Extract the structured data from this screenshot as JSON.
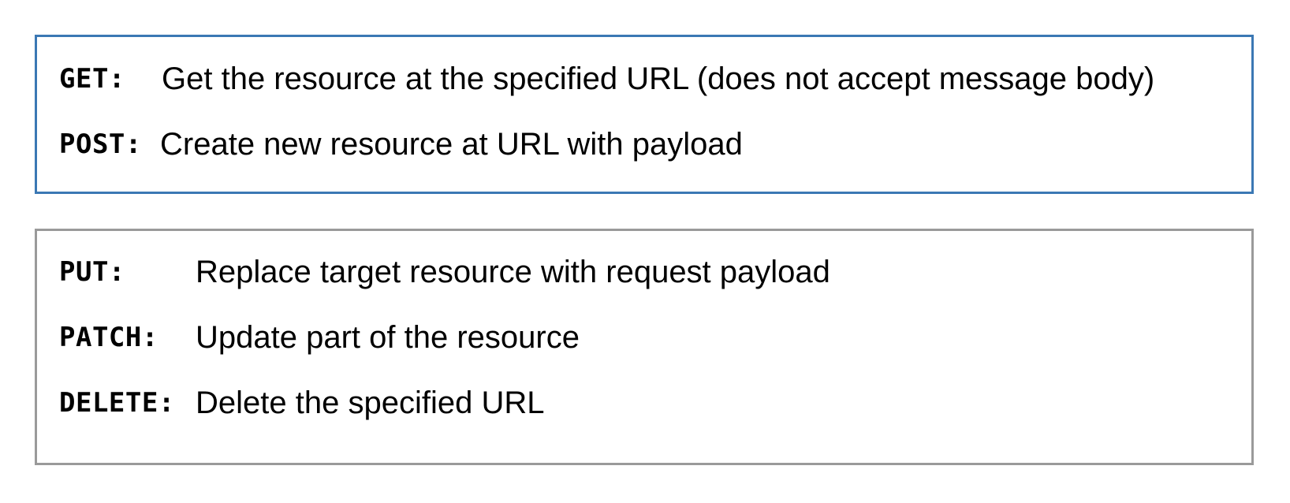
{
  "groups": [
    {
      "items": [
        {
          "method": "GET:",
          "description": "Get the resource at the specified URL (does not accept message body)"
        },
        {
          "method": "POST:",
          "description": "Create new resource at URL with payload"
        }
      ]
    },
    {
      "items": [
        {
          "method": "PUT:",
          "description": "Replace target resource with request payload"
        },
        {
          "method": "PATCH:",
          "description": "Update part of the resource"
        },
        {
          "method": "DELETE:",
          "description": "Delete the specified URL"
        }
      ]
    }
  ],
  "colors": {
    "primary_border": "#3b78b4",
    "secondary_border": "#9a9a9a",
    "text": "#000000"
  }
}
